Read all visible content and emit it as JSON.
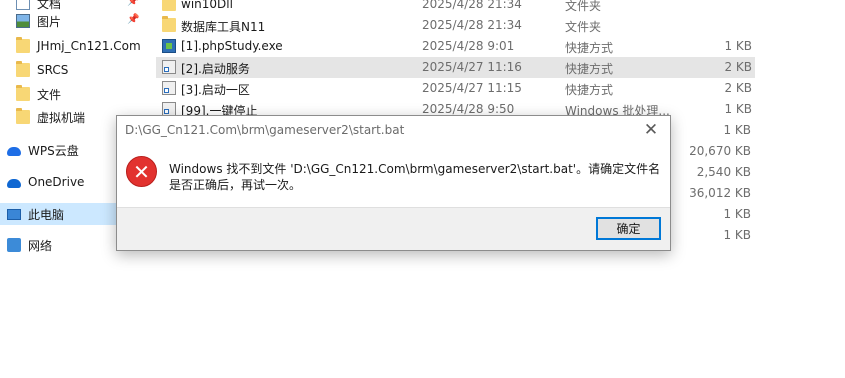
{
  "sidebar": {
    "items": [
      {
        "label": "文档",
        "icon": "document-icon",
        "pinned": true
      },
      {
        "label": "图片",
        "icon": "pictures-icon",
        "pinned": true
      },
      {
        "label": "JHmj_Cn121.Com",
        "icon": "folder-icon"
      },
      {
        "label": "SRCS",
        "icon": "folder-icon"
      },
      {
        "label": "文件",
        "icon": "folder-icon"
      },
      {
        "label": "虚拟机端",
        "icon": "folder-icon"
      },
      {
        "label": "WPS云盘",
        "icon": "cloud-icon"
      },
      {
        "label": "OneDrive",
        "icon": "onedrive-icon"
      },
      {
        "label": "此电脑",
        "icon": "computer-icon"
      },
      {
        "label": "网络",
        "icon": "network-icon"
      }
    ]
  },
  "files": {
    "rows": [
      {
        "name": "win10Dll",
        "date": "2025/4/28 21:34",
        "type": "文件夹",
        "size": "",
        "icon": "folder-icon"
      },
      {
        "name": "数据库工具N11",
        "date": "2025/4/28 21:34",
        "type": "文件夹",
        "size": "",
        "icon": "folder-icon"
      },
      {
        "name": "[1].phpStudy.exe",
        "date": "2025/4/28 9:01",
        "type": "快捷方式",
        "size": "1 KB",
        "icon": "exe-shortcut-icon"
      },
      {
        "name": "[2].启动服务",
        "date": "2025/4/27 11:16",
        "type": "快捷方式",
        "size": "2 KB",
        "icon": "shortcut-icon"
      },
      {
        "name": "[3].启动一区",
        "date": "2025/4/27 11:15",
        "type": "快捷方式",
        "size": "2 KB",
        "icon": "shortcut-icon"
      },
      {
        "name": "[99].一键停止",
        "date": "2025/4/28 9:50",
        "type": "Windows 批处理...",
        "size": "1 KB",
        "icon": "batch-file-icon"
      }
    ],
    "extra_sizes": [
      "1 KB",
      "20,670 KB",
      "2,540 KB",
      "36,012 KB",
      "1 KB",
      "1 KB"
    ]
  },
  "dialog": {
    "title": "D:\\GG_Cn121.Com\\brm\\gameserver2\\start.bat",
    "message": "Windows 找不到文件 'D:\\GG_Cn121.Com\\brm\\gameserver2\\start.bat'。请确定文件名是否正确后，再试一次。",
    "ok_label": "确定",
    "close_glyph": "✕",
    "error_glyph": "✕"
  },
  "colors": {
    "selected_nav": "#cce8ff",
    "selected_row": "#e5e5e5",
    "error_red": "#e2322f",
    "button_focus": "#0078d7"
  }
}
